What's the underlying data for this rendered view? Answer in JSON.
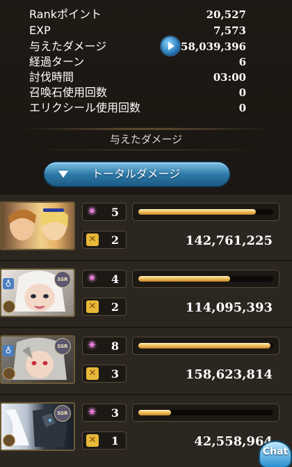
{
  "stats": [
    {
      "label": "Rankポイント",
      "value": "20,527"
    },
    {
      "label": "EXP",
      "value": "7,573"
    },
    {
      "label": "与えたダメージ",
      "value": "458,039,396"
    },
    {
      "label": "経過ターン",
      "value": "6"
    },
    {
      "label": "討伐時間",
      "value": "03:00"
    },
    {
      "label": "召喚石使用回数",
      "value": "0"
    },
    {
      "label": "エリクシール使用回数",
      "value": "0"
    }
  ],
  "section_title": "与えたダメージ",
  "dropdown": {
    "label": "トータルダメージ"
  },
  "characters": [
    {
      "portrait": "duo-portrait",
      "turns": "5",
      "skills": "2",
      "damage": "142,761,225",
      "bar_fraction": 0.87
    },
    {
      "portrait": "white-hair-portrait",
      "turns": "4",
      "skills": "2",
      "damage": "114,095,393",
      "bar_fraction": 0.68,
      "ssr": "SSR"
    },
    {
      "portrait": "silver-hair-portrait",
      "turns": "8",
      "skills": "3",
      "damage": "158,623,814",
      "bar_fraction": 0.98,
      "ssr": "SSR"
    },
    {
      "portrait": "dark-armor-portrait",
      "turns": "3",
      "skills": "1",
      "damage": "42,558,964",
      "bar_fraction": 0.24,
      "ssr": "SSR"
    }
  ],
  "chat_label": "Chat"
}
